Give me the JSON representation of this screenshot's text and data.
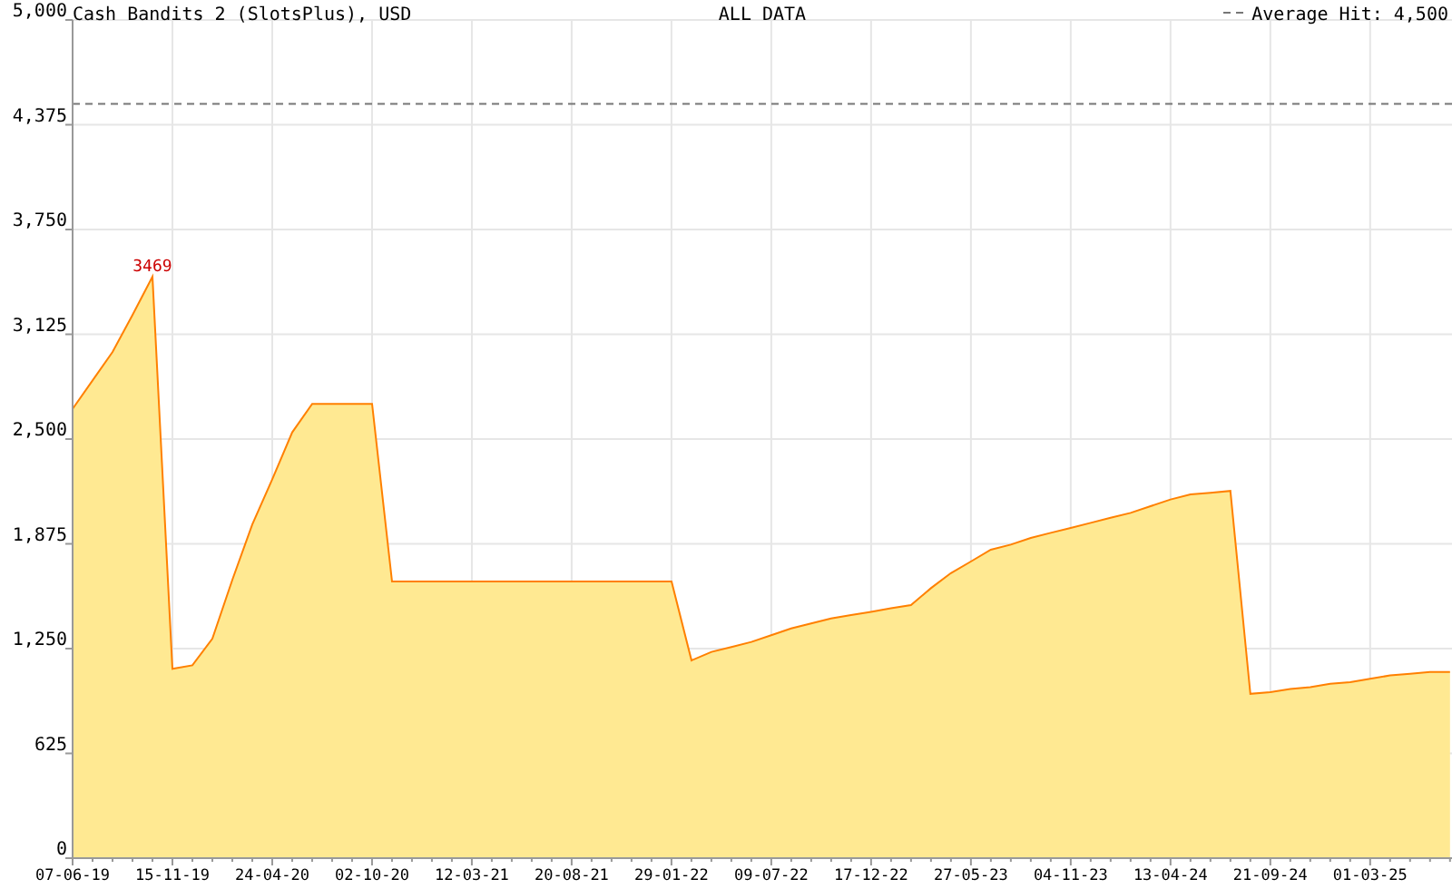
{
  "header": {
    "subtitle": "ALL DATA"
  },
  "chart_data": {
    "type": "area",
    "title": "Cash Bandits 2 (SlotsPlus), USD",
    "categories": [
      "07-06-19",
      null,
      null,
      null,
      null,
      "15-11-19",
      null,
      null,
      null,
      null,
      "24-04-20",
      null,
      null,
      null,
      null,
      "02-10-20",
      null,
      null,
      null,
      null,
      "12-03-21",
      null,
      null,
      null,
      null,
      "20-08-21",
      null,
      null,
      null,
      null,
      "29-01-22",
      null,
      null,
      null,
      null,
      "09-07-22",
      null,
      null,
      null,
      null,
      "17-12-22",
      null,
      null,
      null,
      null,
      "27-05-23",
      null,
      null,
      null,
      null,
      "04-11-23",
      null,
      null,
      null,
      null,
      "13-04-24",
      null,
      null,
      null,
      null,
      "21-09-24",
      null,
      null,
      null,
      null,
      "01-03-25",
      null,
      null,
      null,
      null
    ],
    "series": [
      {
        "color": "#ff8000",
        "values": [
          2680,
          2850,
          3020,
          3240,
          3469,
          1130,
          1150,
          1310,
          1660,
          1990,
          2260,
          2540,
          2710,
          2710,
          2710,
          2710,
          1650,
          1650,
          1650,
          1650,
          1650,
          1650,
          1650,
          1650,
          1650,
          1650,
          1650,
          1650,
          1650,
          1650,
          1650,
          1180,
          1230,
          1260,
          1290,
          1330,
          1370,
          1400,
          1430,
          1450,
          1470,
          1490,
          1510,
          1610,
          1700,
          1770,
          1840,
          1870,
          1910,
          1940,
          1970,
          2000,
          2030,
          2060,
          2100,
          2140,
          2170,
          2180,
          2190,
          980,
          990,
          1010,
          1020,
          1040,
          1050,
          1070,
          1090,
          1100,
          1110,
          1110
        ]
      }
    ],
    "ylim": [
      0,
      5000
    ],
    "yticks": [
      {
        "value": 0,
        "label": "0"
      },
      {
        "value": 625,
        "label": "625"
      },
      {
        "value": 1250,
        "label": "1,250"
      },
      {
        "value": 1875,
        "label": "1,875"
      },
      {
        "value": 2500,
        "label": "2,500"
      },
      {
        "value": 3125,
        "label": "3,125"
      },
      {
        "value": 3750,
        "label": "3,750"
      },
      {
        "value": 4375,
        "label": "4,375"
      },
      {
        "value": 5000,
        "label": "5,000"
      }
    ],
    "grid": true,
    "annotations": [
      {
        "y": 3469,
        "text": "3469"
      }
    ],
    "ref_lines": [
      {
        "axis": "y",
        "value": 4500,
        "label": "Average Hit: 4,500"
      }
    ]
  }
}
